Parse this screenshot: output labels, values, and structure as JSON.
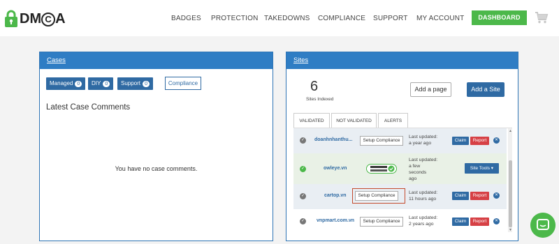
{
  "header": {
    "logo_text": "DMCA",
    "nav": [
      "BADGES",
      "PROTECTION",
      "TAKEDOWNS",
      "COMPLIANCE",
      "SUPPORT",
      "MY ACCOUNT"
    ],
    "dashboard_label": "DASHBOARD",
    "cart_icon": "cart-icon"
  },
  "cases": {
    "title": "Cases",
    "tabs": [
      {
        "label": "Managed",
        "count": "0"
      },
      {
        "label": "DIY",
        "count": "0"
      },
      {
        "label": "Support",
        "count": "0"
      }
    ],
    "compliance_label": "Compliance",
    "latest_title": "Latest Case Comments",
    "empty_text": "You have no case comments."
  },
  "sites": {
    "title": "Sites",
    "count": "6",
    "count_label": "Sites Indexed",
    "add_page_label": "Add a page",
    "add_site_label": "Add a Site",
    "tabs": [
      "VALIDATED",
      "NOT VALIDATED",
      "ALERTS"
    ],
    "rows": [
      {
        "domain": "doanhnhanthu...",
        "action": "Setup Compliance",
        "updated_label": "Last updated:",
        "updated": "a year ago",
        "claim": "Claim",
        "report": "Report",
        "status": "gray"
      },
      {
        "domain": "owleye.vn",
        "badge": "DMCA.com COMPLIANT",
        "updated_label": "Last updated:",
        "updated": "a few seconds ago",
        "tools": "Site Tools ▾",
        "status": "green"
      },
      {
        "domain": "cartop.vn",
        "action": "Setup Compliance",
        "updated_label": "Last updated:",
        "updated": "11 hours ago",
        "claim": "Claim",
        "report": "Report",
        "status": "gray"
      },
      {
        "domain": "vnpmart.com.vn",
        "action": "Setup Compliance",
        "updated_label": "Last updated:",
        "updated": "2 years ago",
        "claim": "Claim",
        "report": "Report",
        "status": "gray"
      }
    ]
  },
  "colors": {
    "brand_blue": "#2f7dc4",
    "brand_green": "#4cb84a",
    "report_red": "#d64045"
  }
}
